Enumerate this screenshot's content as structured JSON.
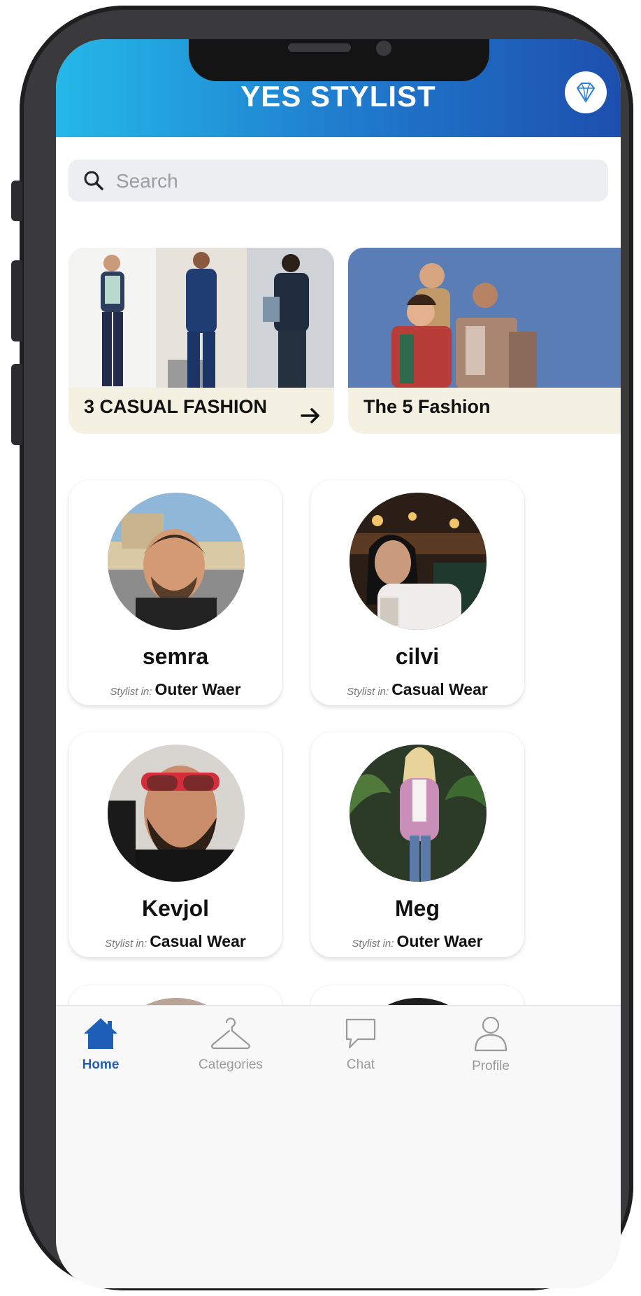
{
  "app": {
    "title": "YES STYLIST"
  },
  "search": {
    "placeholder": "Search"
  },
  "banners": [
    {
      "label": "3 CASUAL FASHION"
    },
    {
      "label": "The 5 Fashion"
    }
  ],
  "stylists": [
    {
      "name": "semra",
      "prefix": "Stylist in:",
      "category": "Outer Waer"
    },
    {
      "name": "cilvi",
      "prefix": "Stylist in:",
      "category": "Casual Wear"
    },
    {
      "name": "Kevjol",
      "prefix": "Stylist in:",
      "category": "Casual Wear"
    },
    {
      "name": "Meg",
      "prefix": "Stylist in:",
      "category": "Outer Waer"
    }
  ],
  "tabs": [
    {
      "label": "Home"
    },
    {
      "label": "Categories"
    },
    {
      "label": "Chat"
    },
    {
      "label": "Profile"
    }
  ],
  "colors": {
    "brand_start": "#24b8e8",
    "brand_end": "#1d4fae",
    "active_tab": "#1f5fb8"
  },
  "icons": [
    "search-icon",
    "diamond-icon",
    "arrow-right-icon",
    "home-icon",
    "hanger-icon",
    "chat-bubble-icon",
    "person-icon"
  ]
}
